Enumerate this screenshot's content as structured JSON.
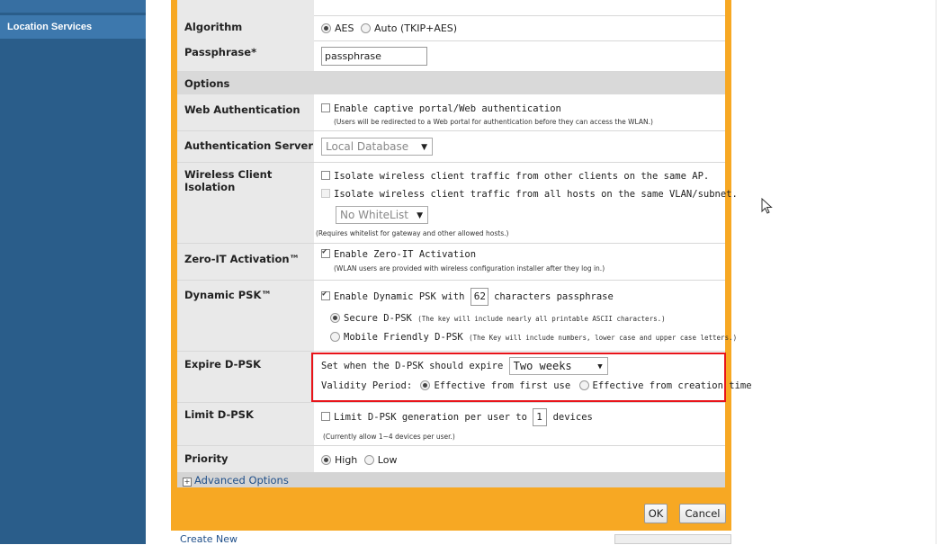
{
  "sidebar": {
    "active_item": "Location Services"
  },
  "form": {
    "algorithm": {
      "label": "Algorithm",
      "opt1": "AES",
      "opt2": "Auto (TKIP+AES)"
    },
    "passphrase": {
      "label": "Passphrase*",
      "value": "passphrase"
    },
    "options_header": "Options",
    "web_auth": {
      "label": "Web Authentication",
      "checkbox": "Enable captive portal/Web authentication",
      "note": "(Users will be redirected to a Web portal for authentication before they can access the WLAN.)"
    },
    "auth_server": {
      "label": "Authentication Server",
      "value": "Local Database"
    },
    "isolation": {
      "label": "Wireless Client Isolation",
      "cb1": "Isolate wireless client traffic from other clients on the same AP.",
      "cb2": "Isolate wireless client traffic from all hosts on the same VLAN/subnet.",
      "whitelist": "No WhiteList",
      "note": "(Requires whitelist for gateway and other allowed hosts.)"
    },
    "zero_it": {
      "label": "Zero-IT Activation™",
      "checkbox": "Enable Zero-IT Activation",
      "note": "(WLAN users are provided with wireless configuration installer after they log in.)"
    },
    "dpsk": {
      "label": "Dynamic PSK™",
      "enable_prefix": "Enable Dynamic PSK with",
      "length": "62",
      "enable_suffix": "characters passphrase",
      "secure_label": "Secure D-PSK",
      "secure_note": "(The key will include nearly all printable ASCII characters.)",
      "mobile_label": "Mobile Friendly D-PSK",
      "mobile_note": "(The Key will include numbers, lower case and upper case letters.)"
    },
    "expire": {
      "label": "Expire D-PSK",
      "set_text": "Set when the D-PSK should expire",
      "expire_value": "Two weeks",
      "validity_label": "Validity Period:",
      "opt1": "Effective from first use",
      "opt2": "Effective from creation time"
    },
    "limit": {
      "label": "Limit D-PSK",
      "prefix": "Limit D-PSK generation per user to",
      "value": "1",
      "suffix": "devices",
      "note": "(Currently allow 1~4 devices per user.)"
    },
    "priority": {
      "label": "Priority",
      "opt1": "High",
      "opt2": "Low"
    },
    "advanced": "Advanced Options",
    "ok": "OK",
    "cancel": "Cancel"
  },
  "footer": {
    "create_new": "Create New"
  },
  "colors": {
    "panel": "#f7a823",
    "sidebar": "#2a5d8a",
    "highlight": "#e8141a"
  }
}
